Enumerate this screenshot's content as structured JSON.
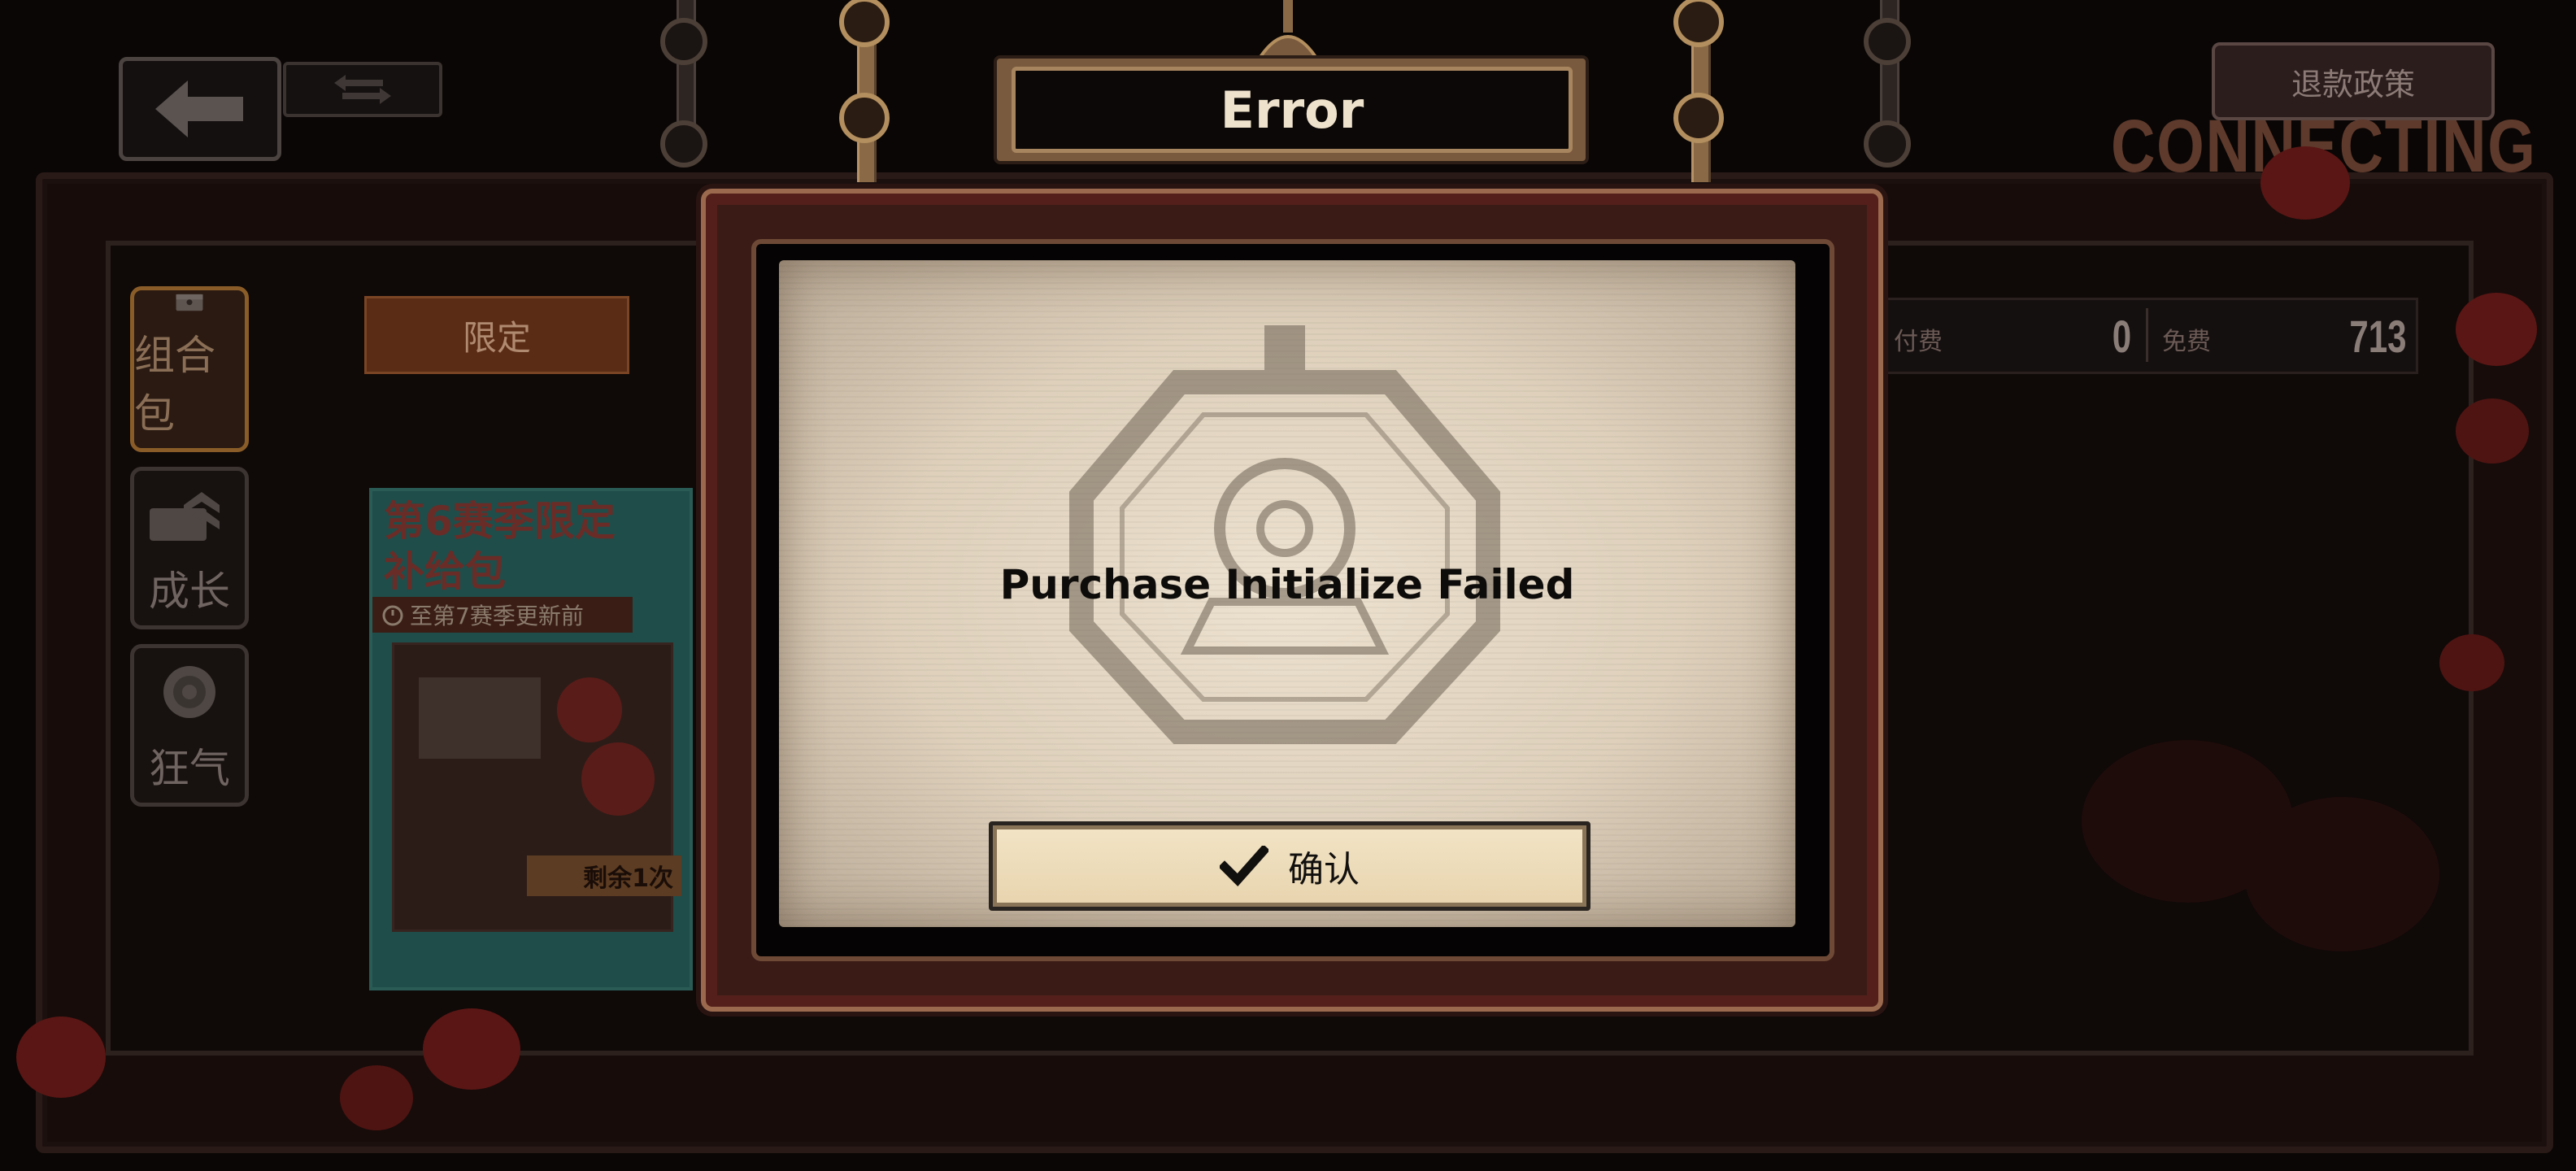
{
  "header": {
    "refund_policy_label": "退款政策",
    "status_label": "CONNECTING"
  },
  "sidebar": {
    "tabs": [
      {
        "label": "组合包",
        "active": true
      },
      {
        "label": "成长",
        "active": false
      },
      {
        "label": "狂气",
        "active": false
      }
    ]
  },
  "shop": {
    "category_tab": "限定",
    "currency": {
      "paid_label": "付费",
      "paid_value": "0",
      "free_label": "免费",
      "free_value": "713"
    },
    "pack": {
      "title_line1": "第6赛季限定",
      "title_line2": "补给包",
      "time_limit": "至第7赛季更新前",
      "remaining": "剩余1次"
    }
  },
  "dialog": {
    "title": "Error",
    "message": "Purchase Initialize Failed",
    "confirm_label": "确认"
  },
  "colors": {
    "dialog_title_text": "#efe2cc",
    "paper": "#e6d9c4",
    "brass": "#a7855e",
    "frame_red": "#541f1a"
  }
}
